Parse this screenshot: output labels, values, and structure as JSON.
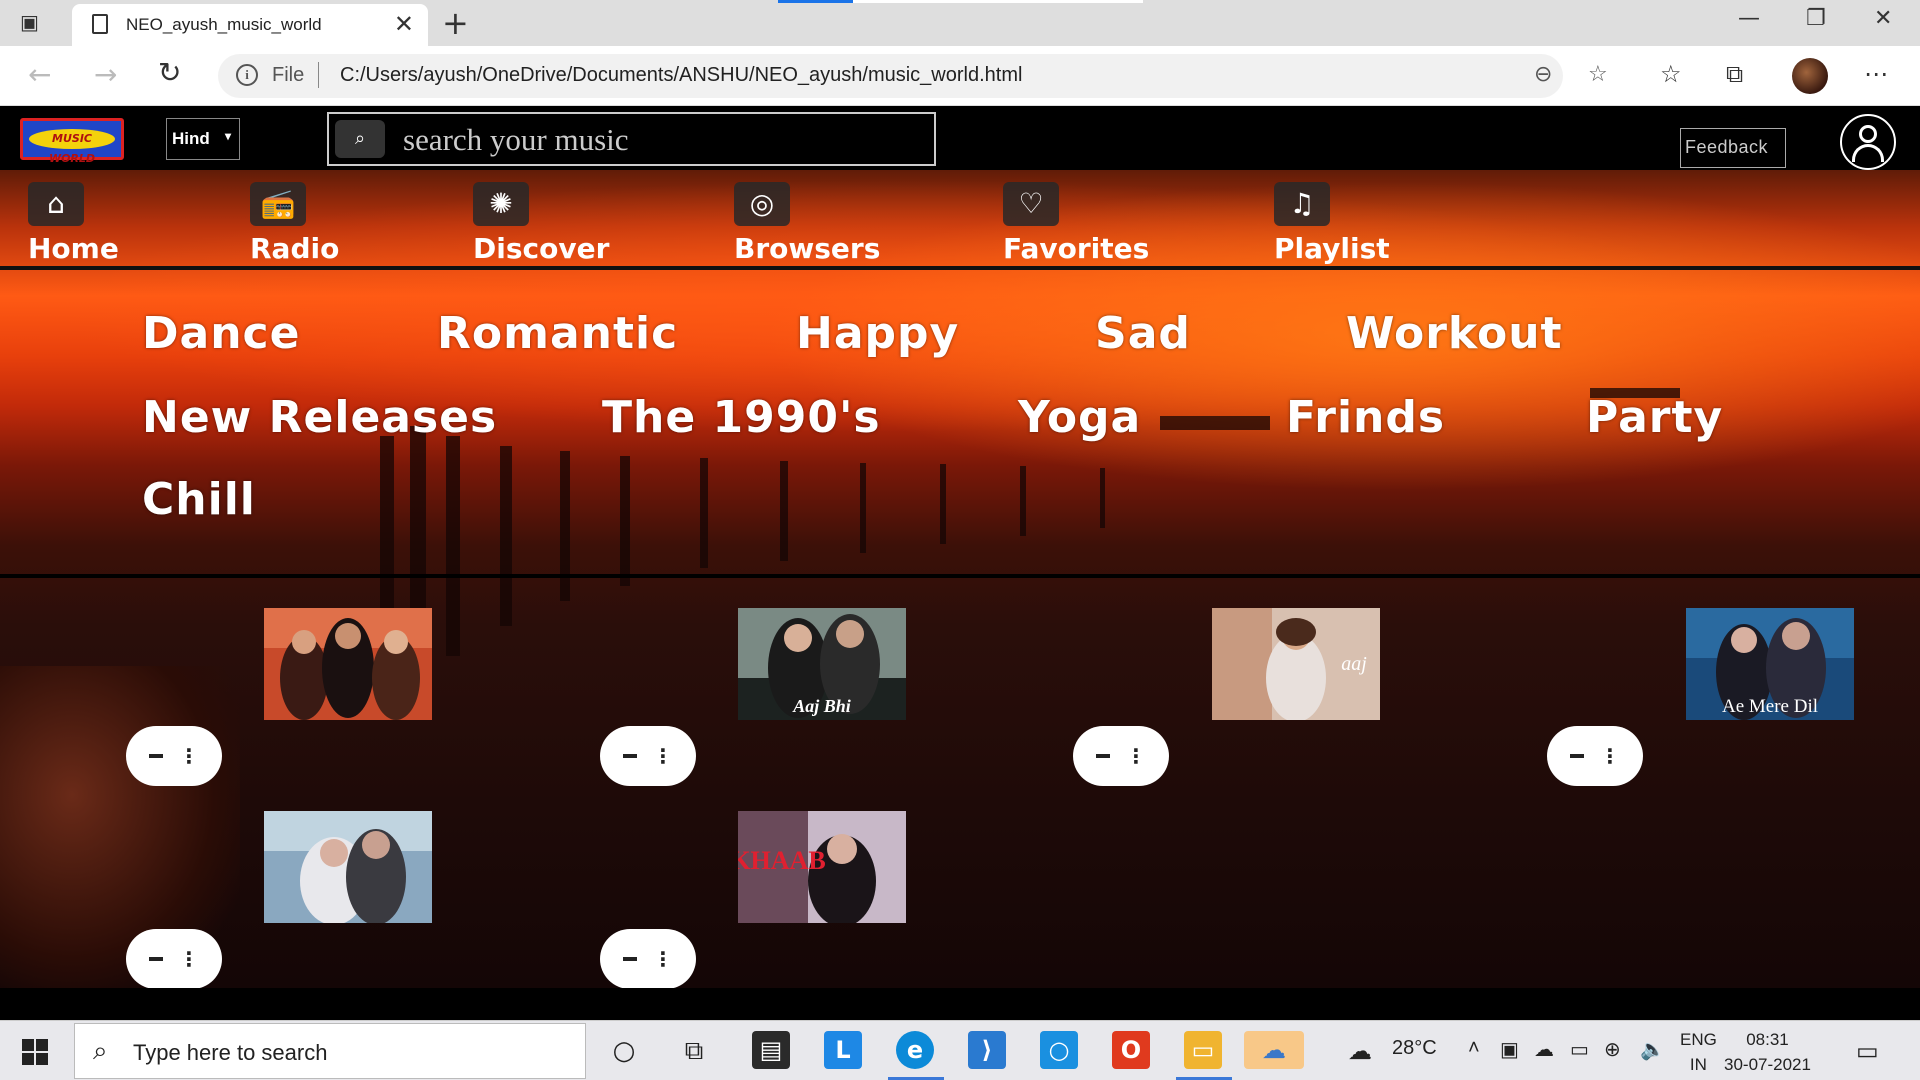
{
  "browser": {
    "tab_title": "NEO_ayush_music_world",
    "file_label": "File",
    "url": "C:/Users/ayush/OneDrive/Documents/ANSHU/NEO_ayush/music_world.html"
  },
  "header": {
    "logo_text": "MUSIC WORLD",
    "language": "Hind",
    "search_placeholder": "search your music",
    "feedback_label": "Feedback"
  },
  "nav": [
    {
      "label": "Home",
      "icon": "home-icon"
    },
    {
      "label": "Radio",
      "icon": "radio-icon"
    },
    {
      "label": "Discover",
      "icon": "discover-icon"
    },
    {
      "label": "Browsers",
      "icon": "browse-icon"
    },
    {
      "label": "Favorites",
      "icon": "heart-icon"
    },
    {
      "label": "Playlist",
      "icon": "playlist-icon"
    }
  ],
  "genres": [
    "Dance",
    "Romantic",
    "Happy",
    "Sad",
    "Workout",
    "New Releases",
    "The 1990's",
    "Yoga",
    "Frinds",
    "Party",
    "Chill"
  ],
  "songs": [
    {
      "thumb_text": ""
    },
    {
      "thumb_text": "Aaj Bhi"
    },
    {
      "thumb_text": "aaj"
    },
    {
      "thumb_text": "Ae Mere Dil"
    },
    {
      "thumb_text": ""
    },
    {
      "thumb_text": "KHAAB"
    }
  ],
  "taskbar": {
    "search_placeholder": "Type here to search",
    "temperature": "28°C",
    "lang_line1": "ENG",
    "lang_line2": "IN",
    "time": "08:31",
    "date": "30-07-2021"
  },
  "colors": {
    "accent": "#3b78d8",
    "sunset_orange": "#ff5a14",
    "logo_blue": "#2046c8",
    "logo_yellow": "#f4d20c"
  }
}
